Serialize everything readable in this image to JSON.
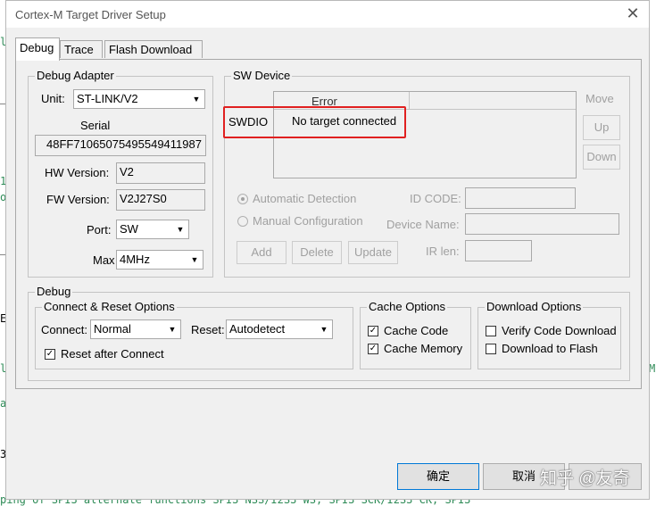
{
  "background": {
    "code_lines": [
      "l",
      "_l",
      "1",
      "o:",
      "_l",
      "E l",
      "li",
      "al",
      "3",
      "ping of SPI3 alternate functions SPI3 NSS/I2S3 WS, SPI3 SCK/I2S3 CK, SPI3"
    ],
    "right_fragment": "M"
  },
  "window": {
    "title": "Cortex-M Target Driver Setup",
    "close_glyph": "✕"
  },
  "tabs": [
    "Debug",
    "Trace",
    "Flash Download"
  ],
  "debug_adapter": {
    "legend": "Debug Adapter",
    "unit_label": "Unit:",
    "unit_value": "ST-LINK/V2",
    "serial_label": "Serial",
    "serial_value": "48FF71065075495549411987",
    "hw_label": "HW Version:",
    "hw_value": "V2",
    "fw_label": "FW Version:",
    "fw_value": "V2J27S0",
    "port_label": "Port:",
    "port_value": "SW",
    "max_label": "Max",
    "max_value": "4MHz"
  },
  "sw_device": {
    "legend": "SW Device",
    "col_error": "Error",
    "row_label": "SWDIO",
    "row_value": "No target connected",
    "move_label": "Move",
    "up_label": "Up",
    "down_label": "Down",
    "auto_detect": "Automatic Detection",
    "manual_config": "Manual Configuration",
    "id_code_label": "ID CODE:",
    "device_name_label": "Device Name:",
    "ir_len_label": "IR len:",
    "add_label": "Add",
    "delete_label": "Delete",
    "update_label": "Update"
  },
  "debug": {
    "legend": "Debug",
    "connect_reset": {
      "legend": "Connect & Reset Options",
      "connect_label": "Connect:",
      "connect_value": "Normal",
      "reset_label": "Reset:",
      "reset_value": "Autodetect",
      "reset_after_label": "Reset after Connect",
      "reset_after_checked": true
    },
    "cache": {
      "legend": "Cache Options",
      "cache_code": "Cache Code",
      "cache_code_checked": true,
      "cache_memory": "Cache Memory",
      "cache_memory_checked": true
    },
    "download": {
      "legend": "Download Options",
      "verify": "Verify Code Download",
      "verify_checked": false,
      "download_flash": "Download to Flash",
      "download_flash_checked": false
    }
  },
  "footer": {
    "ok_label": "确定",
    "cancel_label": "取消",
    "watermark": "知乎 @友奇"
  },
  "colors": {
    "highlight": "#e02020",
    "disabled_text": "#a0a0a0",
    "code_green": "#2e8b57"
  }
}
